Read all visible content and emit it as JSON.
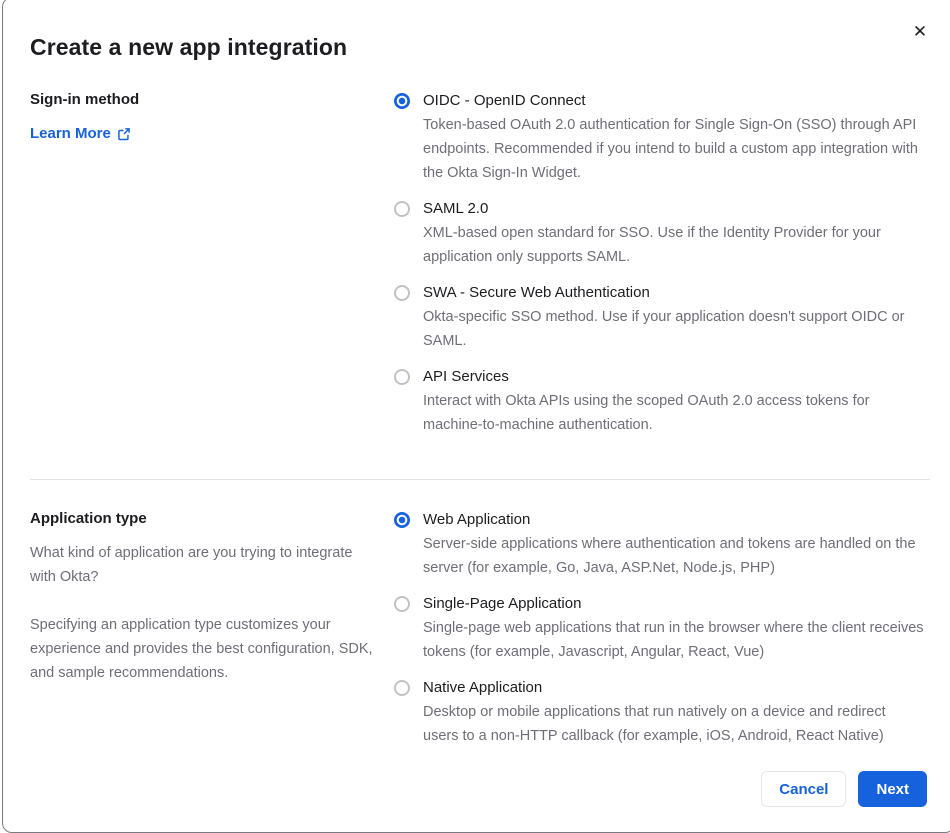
{
  "dialog": {
    "title": "Create a new app integration",
    "close_icon": "✕"
  },
  "signin_section": {
    "label": "Sign-in method",
    "learn_more_label": "Learn More",
    "options": [
      {
        "label": "OIDC - OpenID Connect",
        "description": "Token-based OAuth 2.0 authentication for Single Sign-On (SSO) through API endpoints. Recommended if you intend to build a custom app integration with the Okta Sign-In Widget.",
        "selected": true
      },
      {
        "label": "SAML 2.0",
        "description": "XML-based open standard for SSO. Use if the Identity Provider for your application only supports SAML.",
        "selected": false
      },
      {
        "label": "SWA - Secure Web Authentication",
        "description": "Okta-specific SSO method. Use if your application doesn't support OIDC or SAML.",
        "selected": false
      },
      {
        "label": "API Services",
        "description": "Interact with Okta APIs using the scoped OAuth 2.0 access tokens for machine-to-machine authentication.",
        "selected": false
      }
    ]
  },
  "apptype_section": {
    "label": "Application type",
    "description_1": "What kind of application are you trying to integrate with Okta?",
    "description_2": "Specifying an application type customizes your experience and provides the best configuration, SDK, and sample recommendations.",
    "options": [
      {
        "label": "Web Application",
        "description": "Server-side applications where authentication and tokens are handled on the server (for example, Go, Java, ASP.Net, Node.js, PHP)",
        "selected": true
      },
      {
        "label": "Single-Page Application",
        "description": "Single-page web applications that run in the browser where the client receives tokens (for example, Javascript, Angular, React, Vue)",
        "selected": false
      },
      {
        "label": "Native Application",
        "description": "Desktop or mobile applications that run natively on a device and redirect users to a non-HTTP callback (for example, iOS, Android, React Native)",
        "selected": false
      }
    ]
  },
  "footer": {
    "cancel_label": "Cancel",
    "next_label": "Next"
  },
  "colors": {
    "accent_blue": "#1662dd",
    "text_dark": "#1d1d21",
    "text_gray": "#6e6e78",
    "divider": "#e1e1e6",
    "radio_unselected_border": "#c1c1c8"
  }
}
